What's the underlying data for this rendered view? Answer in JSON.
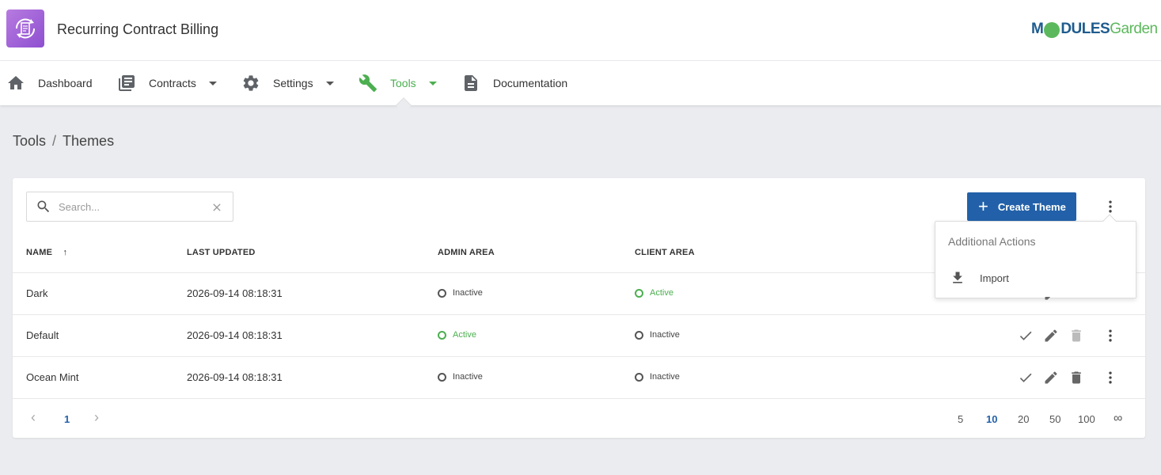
{
  "header": {
    "title": "Recurring Contract Billing",
    "brand_bold": "M",
    "brand_dules": "DULES",
    "brand_garden": "Garden"
  },
  "nav": [
    {
      "label": "Dashboard",
      "icon": "home-icon"
    },
    {
      "label": "Contracts",
      "icon": "contracts-icon"
    },
    {
      "label": "Settings",
      "icon": "gear-icon"
    },
    {
      "label": "Tools",
      "icon": "wrench-icon",
      "active": true
    },
    {
      "label": "Documentation",
      "icon": "document-icon"
    }
  ],
  "breadcrumb": {
    "parent": "Tools",
    "separator": "/",
    "current": "Themes"
  },
  "search": {
    "placeholder": "Search...",
    "value": ""
  },
  "create_button": "Create Theme",
  "table": {
    "headers": {
      "name": "NAME",
      "sort_indicator": "↑",
      "last_updated": "LAST UPDATED",
      "admin_area": "ADMIN AREA",
      "client_area": "CLIENT AREA"
    },
    "rows": [
      {
        "name": "Dark",
        "last_updated": "2026-09-14 08:18:31",
        "admin_area": "Inactive",
        "client_area": "Active"
      },
      {
        "name": "Default",
        "last_updated": "2026-09-14 08:18:31",
        "admin_area": "Active",
        "client_area": "Inactive"
      },
      {
        "name": "Ocean Mint",
        "last_updated": "2026-09-14 08:18:31",
        "admin_area": "Inactive",
        "client_area": "Inactive"
      }
    ]
  },
  "pagination": {
    "prev": "‹",
    "current_page": "1",
    "next": "›",
    "page_sizes": [
      "5",
      "10",
      "20",
      "50",
      "100",
      "∞"
    ],
    "selected_size": "10"
  },
  "dropdown": {
    "title": "Additional Actions",
    "items": [
      {
        "label": "Import",
        "icon": "download-icon"
      }
    ]
  },
  "colors": {
    "accent": "#2261a9",
    "active": "#4caf50",
    "app_logo": "#a35fdb"
  }
}
